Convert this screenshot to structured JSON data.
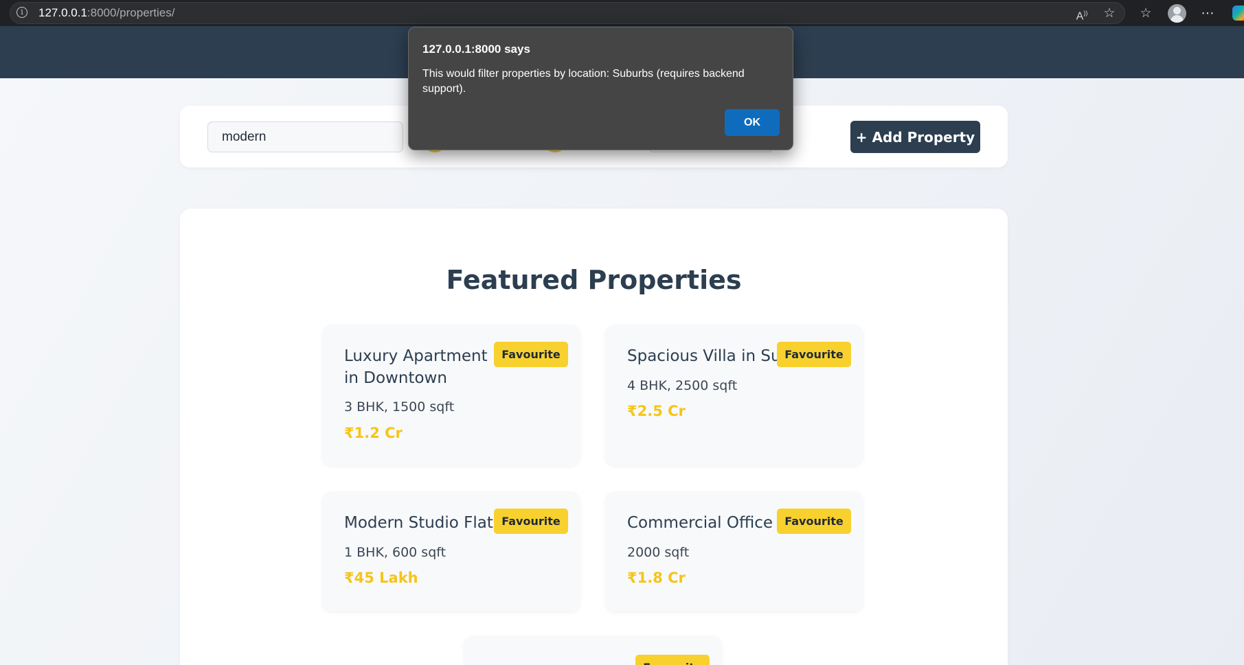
{
  "browser": {
    "url_host": "127.0.0.1",
    "url_rest": ":8000/properties/",
    "icons": [
      "site-info-icon",
      "read-aloud-icon",
      "favorite-star-icon",
      "favorites-list-icon",
      "profile-avatar",
      "more-options-icon",
      "copilot-icon"
    ]
  },
  "toolbar": {
    "search_value": "modern",
    "add_label": "+ Add Property"
  },
  "main": {
    "title": "Featured Properties",
    "properties": [
      {
        "title": "Luxury Apartment in Downtown",
        "meta": "3 BHK, 1500 sqft",
        "price": "₹1.2 Cr",
        "fav_label": "Favourite"
      },
      {
        "title": "Spacious Villa in Suburbs",
        "meta": "4 BHK, 2500 sqft",
        "price": "₹2.5 Cr",
        "fav_label": "Favourite"
      },
      {
        "title": "Modern Studio Flat",
        "meta": "1 BHK, 600 sqft",
        "price": "₹45 Lakh",
        "fav_label": "Favourite"
      },
      {
        "title": "Commercial Office Space",
        "meta": "2000 sqft",
        "price": "₹1.8 Cr",
        "fav_label": "Favourite"
      },
      {
        "fav_label": "Favourite"
      }
    ]
  },
  "alert": {
    "title": "127.0.0.1:8000 says",
    "message": "This would filter properties by location: Suburbs (requires backend support).",
    "ok_label": "OK"
  },
  "colors": {
    "header": "#2c3e50",
    "accent_yellow": "#f8d12f",
    "price_yellow": "#f5c518",
    "dialog_button": "#0f6cbd"
  }
}
